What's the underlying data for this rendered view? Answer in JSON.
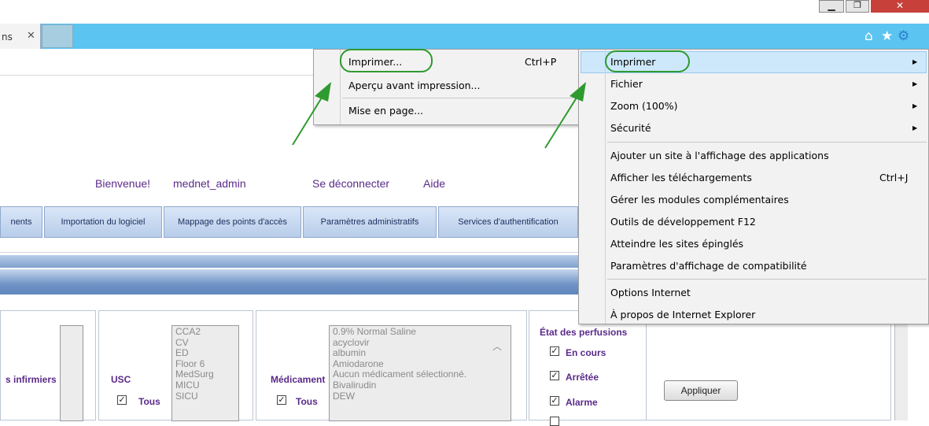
{
  "window": {
    "minimize": "▁",
    "maximize": "❐",
    "close": "✕"
  },
  "tab": {
    "label": "ns",
    "close": "✕"
  },
  "toolbar_icons": {
    "home": "⌂",
    "favorites": "★",
    "tools": "⚙"
  },
  "header": {
    "welcome": "Bienvenue!",
    "user": "mednet_admin",
    "logout": "Se déconnecter",
    "help": "Aide"
  },
  "nav_tabs": [
    {
      "label": "nents"
    },
    {
      "label": "Importation du logiciel"
    },
    {
      "label": "Mappage des points d'accès"
    },
    {
      "label": "Paramètres administratifs"
    },
    {
      "label": "Services d'authentification"
    }
  ],
  "filters": {
    "nurses_label": "s infirmiers",
    "usc": {
      "label": "USC",
      "all": "Tous",
      "options": [
        "CCA2",
        "CV",
        "ED",
        "Floor 6",
        "MedSurg",
        "MICU",
        "SICU"
      ]
    },
    "medication": {
      "label": "Médicament",
      "all": "Tous",
      "options": [
        "0.9% Normal Saline",
        "acyclovir",
        "albumin",
        "Amiodarone",
        "Aucun médicament sélectionné.",
        "Bivalirudin",
        "DEW"
      ]
    },
    "infusion_state": {
      "label": "État des perfusions",
      "options": [
        "En cours",
        "Arrêtée",
        "Alarme"
      ]
    },
    "apply": "Appliquer"
  },
  "print_submenu": {
    "items": [
      {
        "label": "Imprimer...",
        "shortcut": "Ctrl+P"
      },
      {
        "label": "Aperçu avant impression...",
        "shortcut": ""
      },
      {
        "label": "Mise en page...",
        "shortcut": ""
      }
    ]
  },
  "tools_menu": {
    "items": [
      {
        "label": "Imprimer",
        "shortcut": ""
      },
      {
        "label": "Fichier",
        "shortcut": ""
      },
      {
        "label": "Zoom (100%)",
        "shortcut": ""
      },
      {
        "label": "Sécurité",
        "shortcut": ""
      },
      {
        "label": "Ajouter un site à l'affichage des applications",
        "shortcut": ""
      },
      {
        "label": "Afficher les téléchargements",
        "shortcut": "Ctrl+J"
      },
      {
        "label": "Gérer les modules complémentaires",
        "shortcut": ""
      },
      {
        "label": "Outils de développement F12",
        "shortcut": ""
      },
      {
        "label": "Atteindre les sites épinglés",
        "shortcut": ""
      },
      {
        "label": "Paramètres d'affichage de compatibilité",
        "shortcut": ""
      },
      {
        "label": "Options Internet",
        "shortcut": ""
      },
      {
        "label": "À propos de Internet Explorer",
        "shortcut": ""
      }
    ]
  },
  "colors": {
    "annotation": "#2f9a2f",
    "tabstrip": "#5bc4f0",
    "highlight": "#cde8fb"
  }
}
